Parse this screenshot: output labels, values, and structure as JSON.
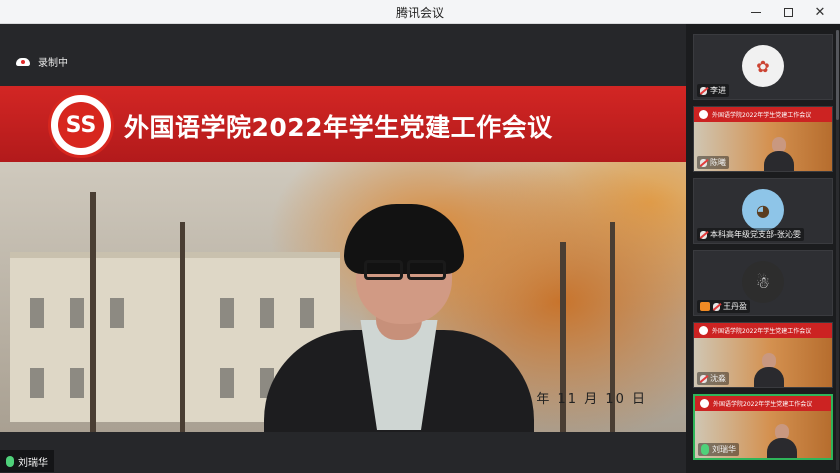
{
  "window": {
    "title": "腾讯会议",
    "controls": {
      "minimize": "",
      "maximize": "",
      "close": "✕"
    }
  },
  "recording": {
    "label": "录制中"
  },
  "shared_screen": {
    "banner_title": "外国语学院2022年学生党建工作会议",
    "logo_text": "SS",
    "date_text": "2 年 11 月 10 日"
  },
  "active_speaker": {
    "name": "刘瑞华"
  },
  "participants": [
    {
      "name": "李进",
      "view": "avatar"
    },
    {
      "name": "陈曦",
      "view": "slide",
      "slide_banner": "外国语学院2022年学生党建工作会议"
    },
    {
      "name": "本科高年级党支部-张沁雯",
      "view": "avatar"
    },
    {
      "name": "王丹盈",
      "view": "avatar"
    },
    {
      "name": "沈淼",
      "view": "slide",
      "slide_banner": "外国语学院2022年学生党建工作会议"
    },
    {
      "name": "刘瑞华",
      "view": "slide",
      "slide_banner": "外国语学院2022年学生党建工作会议",
      "active": true
    }
  ],
  "colors": {
    "accent_red": "#cc2322",
    "speaking_green": "#2fb55a"
  }
}
